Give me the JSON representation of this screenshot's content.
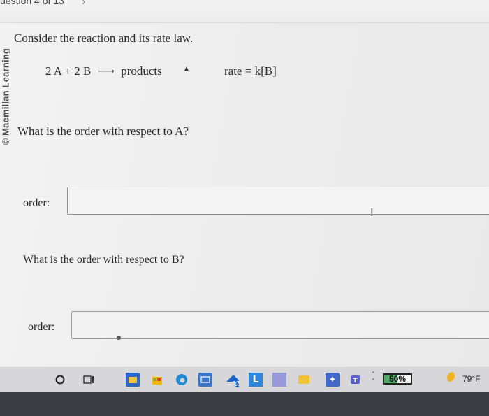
{
  "header": {
    "question_counter": "uestion 4 of 13"
  },
  "side_credit": "© Macmillan Learning",
  "question": {
    "prompt": "Consider the reaction and its rate law.",
    "equation": {
      "left": "2 A + 2 B",
      "arrow": "⟶",
      "right": "products"
    },
    "rate_law": "rate = k[B]",
    "part1_question": "What is the order with respect to A?",
    "part1_label": "order:",
    "part1_value": "",
    "part2_question": "What is the order with respect to B?",
    "part2_label": "order:",
    "part2_value": ""
  },
  "taskbar": {
    "icons": [
      "search-icon",
      "task-view-icon",
      "file-explorer-icon",
      "microsoft-store-icon",
      "edge-icon",
      "calendar-icon",
      "teams-icon",
      "mail-icon",
      "photos-icon",
      "app-icon",
      "app-icon-2",
      "teams-icon-2"
    ],
    "calendar_badge": "17",
    "battery": "50%",
    "battery_level": 0.5,
    "weather": "79°F"
  }
}
